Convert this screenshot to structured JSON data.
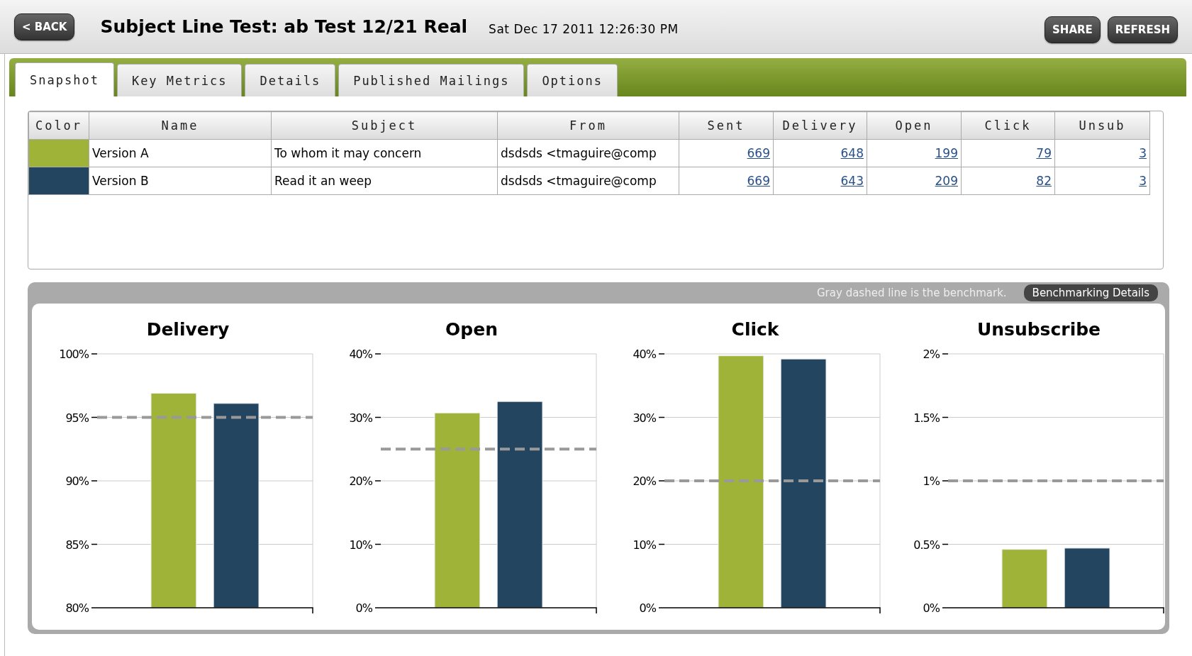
{
  "header": {
    "back_label": "< BACK",
    "title": "Subject Line Test: ab Test 12/21 Real",
    "timestamp": "Sat Dec 17 2011 12:26:30 PM",
    "buttons": [
      "SHARE",
      "REFRESH"
    ]
  },
  "tabs": [
    {
      "label": "Snapshot",
      "selected": true
    },
    {
      "label": "Key Metrics",
      "selected": false
    },
    {
      "label": "Details",
      "selected": false
    },
    {
      "label": "Published Mailings",
      "selected": false
    },
    {
      "label": "Options",
      "selected": false
    }
  ],
  "table": {
    "columns": [
      "Color",
      "Name",
      "Subject",
      "From",
      "Sent",
      "Delivery",
      "Open",
      "Click",
      "Unsub"
    ],
    "rows": [
      {
        "color": "#a0b339",
        "name": "Version A",
        "subject": "To whom it may concern",
        "from": "dsdsds <tmaguire@comp",
        "sent": "669",
        "delivery": "648",
        "open": "199",
        "click": "79",
        "unsub": "3"
      },
      {
        "color": "#244560",
        "name": "Version B",
        "subject": "Read it an weep",
        "from": "dsdsds <tmaguire@comp",
        "sent": "669",
        "delivery": "643",
        "open": "209",
        "click": "82",
        "unsub": "3"
      }
    ]
  },
  "benchmark": {
    "note": "Gray dashed line is the benchmark.",
    "button": "Benchmarking Details"
  },
  "charts": [
    {
      "chart_data": {
        "type": "bar",
        "title": "Delivery",
        "grid": true,
        "ylim": [
          80,
          100
        ],
        "yticks": [
          {
            "value": 80,
            "label": "80%"
          },
          {
            "value": 85,
            "label": "85%"
          },
          {
            "value": 90,
            "label": "90%"
          },
          {
            "value": 95,
            "label": "95%"
          },
          {
            "value": 100,
            "label": "100%"
          }
        ],
        "series": [
          {
            "color": "#a0b339",
            "values": [
              96.9
            ]
          },
          {
            "color": "#244560",
            "values": [
              96.1
            ]
          }
        ],
        "ref_lines": [
          {
            "axis": "y",
            "value": 95
          }
        ]
      }
    },
    {
      "chart_data": {
        "type": "bar",
        "title": "Open",
        "grid": true,
        "ylim": [
          0,
          40
        ],
        "yticks": [
          {
            "value": 0,
            "label": "0%"
          },
          {
            "value": 10,
            "label": "10%"
          },
          {
            "value": 20,
            "label": "20%"
          },
          {
            "value": 30,
            "label": "30%"
          },
          {
            "value": 40,
            "label": "40%"
          }
        ],
        "series": [
          {
            "color": "#a0b339",
            "values": [
              30.7
            ]
          },
          {
            "color": "#244560",
            "values": [
              32.5
            ]
          }
        ],
        "ref_lines": [
          {
            "axis": "y",
            "value": 25
          }
        ]
      }
    },
    {
      "chart_data": {
        "type": "bar",
        "title": "Click",
        "grid": true,
        "ylim": [
          0,
          40
        ],
        "yticks": [
          {
            "value": 0,
            "label": "0%"
          },
          {
            "value": 10,
            "label": "10%"
          },
          {
            "value": 20,
            "label": "20%"
          },
          {
            "value": 30,
            "label": "30%"
          },
          {
            "value": 40,
            "label": "40%"
          }
        ],
        "series": [
          {
            "color": "#a0b339",
            "values": [
              39.7
            ]
          },
          {
            "color": "#244560",
            "values": [
              39.2
            ]
          }
        ],
        "ref_lines": [
          {
            "axis": "y",
            "value": 20
          }
        ]
      }
    },
    {
      "chart_data": {
        "type": "bar",
        "title": "Unsubscribe",
        "grid": true,
        "ylim": [
          0,
          2
        ],
        "yticks": [
          {
            "value": 0,
            "label": "0%"
          },
          {
            "value": 0.5,
            "label": "0.5%"
          },
          {
            "value": 1,
            "label": "1%"
          },
          {
            "value": 1.5,
            "label": "1.5%"
          },
          {
            "value": 2,
            "label": "2%"
          }
        ],
        "series": [
          {
            "color": "#a0b339",
            "values": [
              0.46
            ]
          },
          {
            "color": "#244560",
            "values": [
              0.47
            ]
          }
        ],
        "ref_lines": [
          {
            "axis": "y",
            "value": 1
          }
        ]
      }
    }
  ]
}
